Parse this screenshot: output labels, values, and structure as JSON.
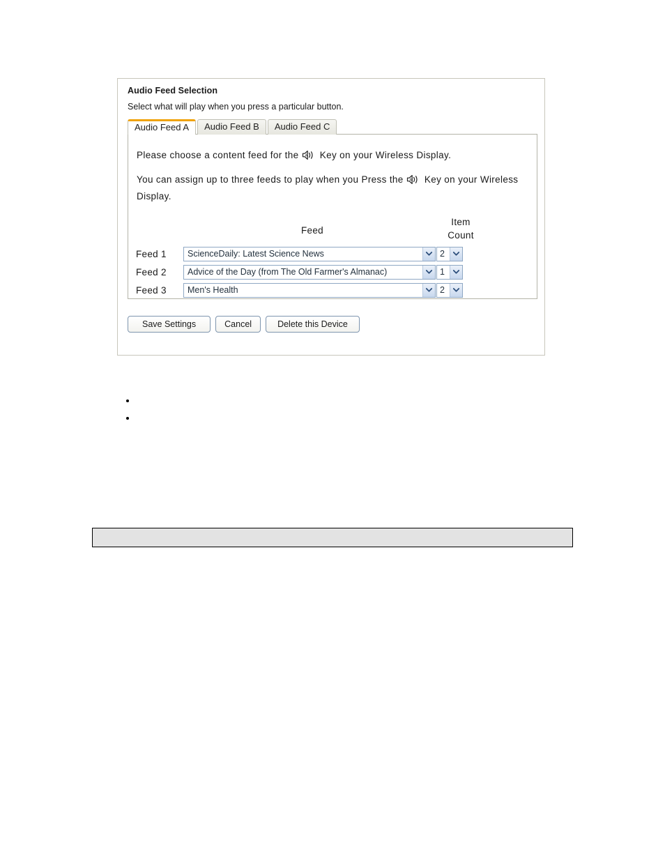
{
  "panel": {
    "title": "Audio Feed Selection",
    "subtitle": "Select what will play when you press a particular button."
  },
  "tabs": [
    {
      "label": "Audio Feed A",
      "active": true
    },
    {
      "label": "Audio Feed B",
      "active": false
    },
    {
      "label": "Audio Feed C",
      "active": false
    }
  ],
  "instructions": {
    "line1_before": "Please choose a content feed for the",
    "line1_after": "Key on your Wireless Display.",
    "line2_before": "You can assign up to three feeds to play when you Press the",
    "line2_after": "Key on your Wireless Display.",
    "speaker_icon": "speaker-audio-icon"
  },
  "table": {
    "headers": {
      "feed": "Feed",
      "item_count_line1": "Item",
      "item_count_line2": "Count"
    },
    "rows": [
      {
        "label": "Feed 1",
        "feed_value": "ScienceDaily: Latest Science News",
        "count_value": "2"
      },
      {
        "label": "Feed 2",
        "feed_value": "Advice of the Day (from The Old Farmer's Almanac)",
        "count_value": "1"
      },
      {
        "label": "Feed 3",
        "feed_value": "Men's Health",
        "count_value": "2"
      }
    ]
  },
  "buttons": {
    "save": "Save Settings",
    "cancel": "Cancel",
    "delete": "Delete this Device"
  },
  "bullets": [
    "",
    ""
  ],
  "colors": {
    "active_tab_accent": "#f0a30a",
    "select_border": "#8fa8c4",
    "button_border": "#7e95ae",
    "panel_border": "#c8c6bb",
    "gray_bar_fill": "#e3e3e3"
  }
}
